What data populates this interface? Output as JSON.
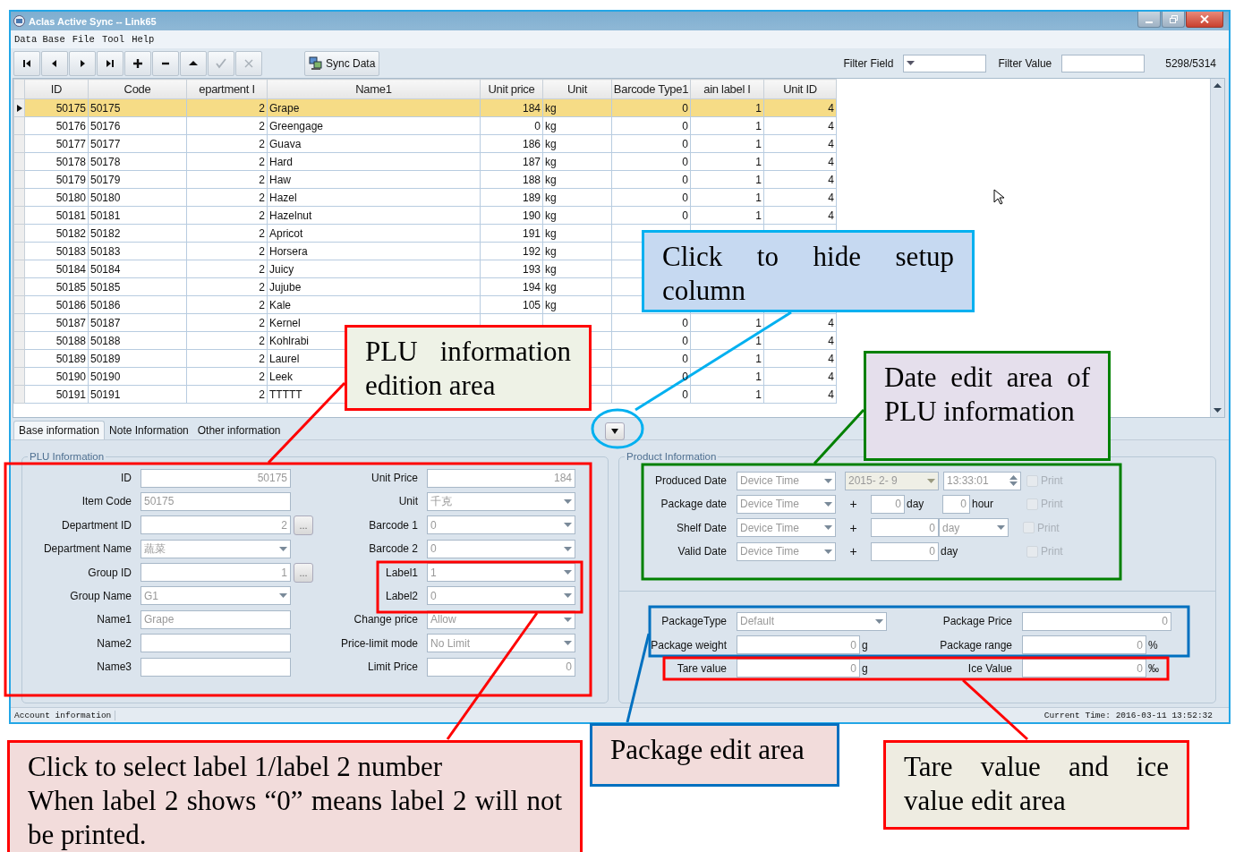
{
  "window": {
    "title": "Aclas Active Sync -- Link65"
  },
  "menu": [
    "Data Base",
    "File",
    "Tool",
    "Help"
  ],
  "toolbar": {
    "nav_buttons": [
      {
        "kind": "first",
        "disabled": false
      },
      {
        "kind": "prev",
        "disabled": false
      },
      {
        "kind": "next",
        "disabled": false
      },
      {
        "kind": "last",
        "disabled": false
      },
      {
        "kind": "add",
        "disabled": false
      },
      {
        "kind": "remove",
        "disabled": false
      },
      {
        "kind": "up",
        "disabled": false
      },
      {
        "kind": "confirm",
        "disabled": true
      },
      {
        "kind": "cancel",
        "disabled": true
      }
    ],
    "sync_button": "Sync Data",
    "filter_field_label": "Filter Field",
    "filter_value_label": "Filter Value",
    "record_count": "5298/5314"
  },
  "table": {
    "columns": [
      "ID",
      "Code",
      "epartment I",
      "Name1",
      "Unit price",
      "Unit",
      "Barcode Type1",
      "ain label I",
      "Unit ID"
    ],
    "rows": [
      {
        "selected": true,
        "cells": [
          "50175",
          "50175",
          "2",
          "Grape",
          "184",
          "kg",
          "0",
          "1",
          "4"
        ]
      },
      {
        "selected": false,
        "cells": [
          "50176",
          "50176",
          "2",
          "Greengage",
          "0",
          "kg",
          "0",
          "1",
          "4"
        ]
      },
      {
        "selected": false,
        "cells": [
          "50177",
          "50177",
          "2",
          "Guava",
          "186",
          "kg",
          "0",
          "1",
          "4"
        ]
      },
      {
        "selected": false,
        "cells": [
          "50178",
          "50178",
          "2",
          "Hard",
          "187",
          "kg",
          "0",
          "1",
          "4"
        ]
      },
      {
        "selected": false,
        "cells": [
          "50179",
          "50179",
          "2",
          "Haw",
          "188",
          "kg",
          "0",
          "1",
          "4"
        ]
      },
      {
        "selected": false,
        "cells": [
          "50180",
          "50180",
          "2",
          "Hazel",
          "189",
          "kg",
          "0",
          "1",
          "4"
        ]
      },
      {
        "selected": false,
        "cells": [
          "50181",
          "50181",
          "2",
          "Hazelnut",
          "190",
          "kg",
          "0",
          "1",
          "4"
        ]
      },
      {
        "selected": false,
        "cells": [
          "50182",
          "50182",
          "2",
          "Apricot",
          "191",
          "kg",
          null,
          null,
          null
        ]
      },
      {
        "selected": false,
        "cells": [
          "50183",
          "50183",
          "2",
          "Horsera",
          "192",
          "kg",
          null,
          null,
          null
        ]
      },
      {
        "selected": false,
        "cells": [
          "50184",
          "50184",
          "2",
          "Juicy",
          "193",
          "kg",
          null,
          null,
          null
        ]
      },
      {
        "selected": false,
        "cells": [
          "50185",
          "50185",
          "2",
          "Jujube",
          "194",
          "kg",
          null,
          null,
          null
        ]
      },
      {
        "selected": false,
        "cells": [
          "50186",
          "50186",
          "2",
          "Kale",
          "105",
          "kg",
          null,
          null,
          null
        ]
      },
      {
        "selected": false,
        "cells": [
          "50187",
          "50187",
          "2",
          "Kernel",
          null,
          null,
          "0",
          "1",
          "4"
        ]
      },
      {
        "selected": false,
        "cells": [
          "50188",
          "50188",
          "2",
          "Kohlrabi",
          null,
          null,
          "0",
          "1",
          "4"
        ]
      },
      {
        "selected": false,
        "cells": [
          "50189",
          "50189",
          "2",
          "Laurel",
          null,
          null,
          "0",
          "1",
          "4"
        ]
      },
      {
        "selected": false,
        "cells": [
          "50190",
          "50190",
          "2",
          "Leek",
          null,
          null,
          "0",
          "1",
          "4"
        ]
      },
      {
        "selected": false,
        "cells": [
          "50191",
          "50191",
          "2",
          "TTTTT",
          null,
          null,
          "0",
          "1",
          "4"
        ]
      }
    ]
  },
  "tabs": [
    {
      "label": "Base information",
      "selected": true
    },
    {
      "label": "Note Information",
      "selected": false
    },
    {
      "label": "Other information",
      "selected": false
    }
  ],
  "plu_information": {
    "title": "PLU Information",
    "left_fields": [
      {
        "label": "ID",
        "kind": "number",
        "value": "50175"
      },
      {
        "label": "Item Code",
        "kind": "text",
        "value": "50175"
      },
      {
        "label": "Department ID",
        "kind": "lookup",
        "value": "2",
        "button": "..."
      },
      {
        "label": "Department Name",
        "kind": "dropdown",
        "value": "蔬菜"
      },
      {
        "label": "Group ID",
        "kind": "lookup",
        "value": "1",
        "button": "..."
      },
      {
        "label": "Group Name",
        "kind": "dropdown",
        "value": "G1"
      },
      {
        "label": "Name1",
        "kind": "text",
        "value": "Grape"
      },
      {
        "label": "Name2",
        "kind": "text"
      },
      {
        "label": "Name3",
        "kind": "text"
      }
    ],
    "right_fields": [
      {
        "label": "Unit Price",
        "kind": "number",
        "value": "184"
      },
      {
        "label": "Unit",
        "kind": "dropdown",
        "value": "千克"
      },
      {
        "label": "Barcode 1",
        "kind": "dropdown",
        "value": "0"
      },
      {
        "label": "Barcode 2",
        "kind": "dropdown",
        "value": "0"
      },
      {
        "label": "Label1",
        "kind": "dropdown",
        "value": "1"
      },
      {
        "label": "Label2",
        "kind": "dropdown",
        "value": "0"
      },
      {
        "label": "Change price",
        "kind": "dropdown",
        "value": "Allow"
      },
      {
        "label": "Price-limit mode",
        "kind": "dropdown",
        "value": "No Limit"
      },
      {
        "label": "Limit Price",
        "kind": "number",
        "value": "0"
      }
    ]
  },
  "product_information": {
    "title": "Product Information",
    "dates": [
      {
        "label": "Produced Date",
        "kind": "datetime",
        "source": "Device Time",
        "date": "2015- 2- 9",
        "time": "13:33:01",
        "print_label": "Print",
        "print_checked": false
      },
      {
        "label": "Package date",
        "kind": "day_hour",
        "source": "Device Time",
        "plus": "+",
        "days": "0",
        "day_unit": "day",
        "hours": "0",
        "hour_unit": "hour",
        "print_label": "Print",
        "print_checked": false
      },
      {
        "label": "Shelf Date",
        "kind": "day_select",
        "source": "Device Time",
        "plus": "+",
        "days": "0",
        "day_unit": "day",
        "print_label": "Print",
        "print_checked": false
      },
      {
        "label": "Valid Date",
        "kind": "day",
        "source": "Device Time",
        "plus": "+",
        "days": "0",
        "day_unit": "day",
        "print_label": "Print",
        "print_checked": false
      }
    ],
    "package": {
      "package_type_label": "PackageType",
      "package_type": "Default",
      "package_price_label": "Package Price",
      "package_price": "0",
      "package_weight_label": "Package weight",
      "package_weight": "0",
      "package_weight_unit": "g",
      "package_range_label": "Package range",
      "package_range": "0",
      "package_range_unit": "%",
      "tare_label": "Tare value",
      "tare": "0",
      "tare_unit": "g",
      "ice_label": "Ice Value",
      "ice": "0",
      "ice_unit": "‰"
    }
  },
  "status_bar": {
    "left": "Account information",
    "right": "Current Time: 2016-03-11 13:52:32"
  },
  "annotations": [
    {
      "color": "#00b0f0",
      "lines": [
        "Click to hide setup column"
      ]
    },
    {
      "color": "#ff0000",
      "lines": [
        "PLU information edition area"
      ]
    },
    {
      "color": "#008000",
      "lines": [
        "Date edit area of PLU information"
      ]
    },
    {
      "color": "#ff0000",
      "lines": [
        "Click to select label 1/label 2 number",
        "When label 2 shows “0” means label 2 will not be printed."
      ]
    },
    {
      "color": "#0070c0",
      "lines": [
        "Package edit area"
      ]
    },
    {
      "color": "#ff0000",
      "lines": [
        "Tare value and ice value edit area"
      ]
    }
  ]
}
